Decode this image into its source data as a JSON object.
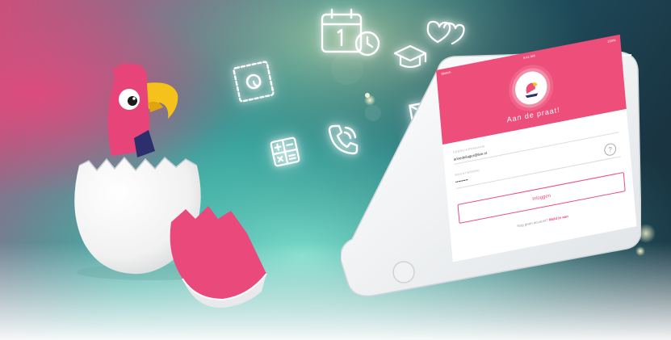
{
  "scene": {
    "description_icons": [
      "calendar-clock-icon",
      "heart-bubbles-icon",
      "email-stamp-icon",
      "graduation-cap-icon",
      "envelope-icon",
      "calculator-icon",
      "phone-call-icon"
    ],
    "colors": {
      "brand_pink": "#ee4f7a",
      "beak_yellow": "#f4c21b",
      "bg_teal": "#3fb3a8",
      "bg_dark": "#1d3d4e"
    }
  },
  "phone": {
    "status": {
      "carrier": "Sketch",
      "time": "9:41 AM",
      "battery": "100%"
    },
    "app_title": "Aan de praat!",
    "username_label": "GEBRUIKERSNAAM",
    "username_value": "annedeilager@live.nl",
    "password_label": "WACHTWOORD",
    "password_value": "••••••••••",
    "help_label": "?",
    "login_button": "Inloggen",
    "signup_prompt": "Nog geen account?",
    "signup_link": "Meld je aan"
  }
}
